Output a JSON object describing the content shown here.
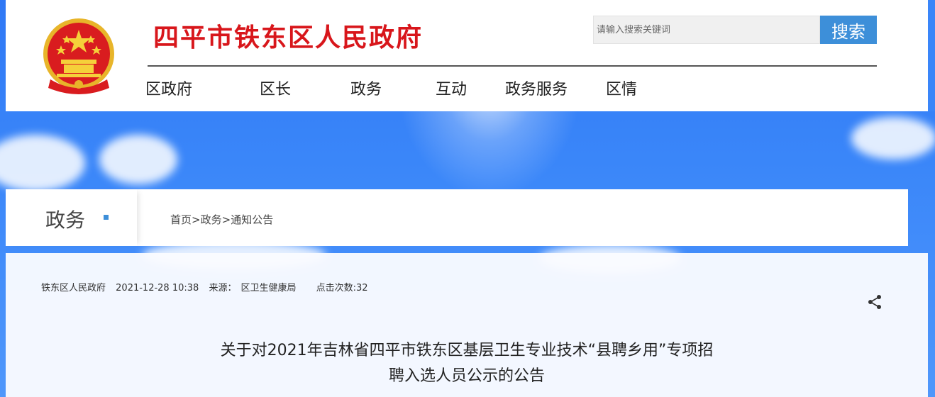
{
  "site": {
    "title": "四平市铁东区人民政府"
  },
  "search": {
    "placeholder": "请输入搜索关键词",
    "button_label": "搜索"
  },
  "nav": {
    "items": [
      "区政府",
      "区长",
      "政务",
      "互动",
      "政务服务",
      "区情"
    ]
  },
  "section": {
    "title": "政务"
  },
  "breadcrumb": {
    "home": "首页",
    "sep1": ">",
    "level1": "政务",
    "sep2": ">",
    "level2": "通知公告"
  },
  "article": {
    "publisher": "铁东区人民政府",
    "datetime": "2021-12-28 10:38",
    "source_label": "来源：",
    "source": "区卫生健康局",
    "clicks": "点击次数:32",
    "title_line1": "关于对2021年吉林省四平市铁东区基层卫生专业技术“县聘乡用”专项招",
    "title_line2": "聘入选人员公示的公告"
  },
  "icons": {
    "emblem": "national-emblem",
    "share": "share-icon"
  },
  "colors": {
    "title_red": "#d8161b",
    "search_button": "#3d8fd9",
    "sky_blue": "#3a86f9"
  }
}
